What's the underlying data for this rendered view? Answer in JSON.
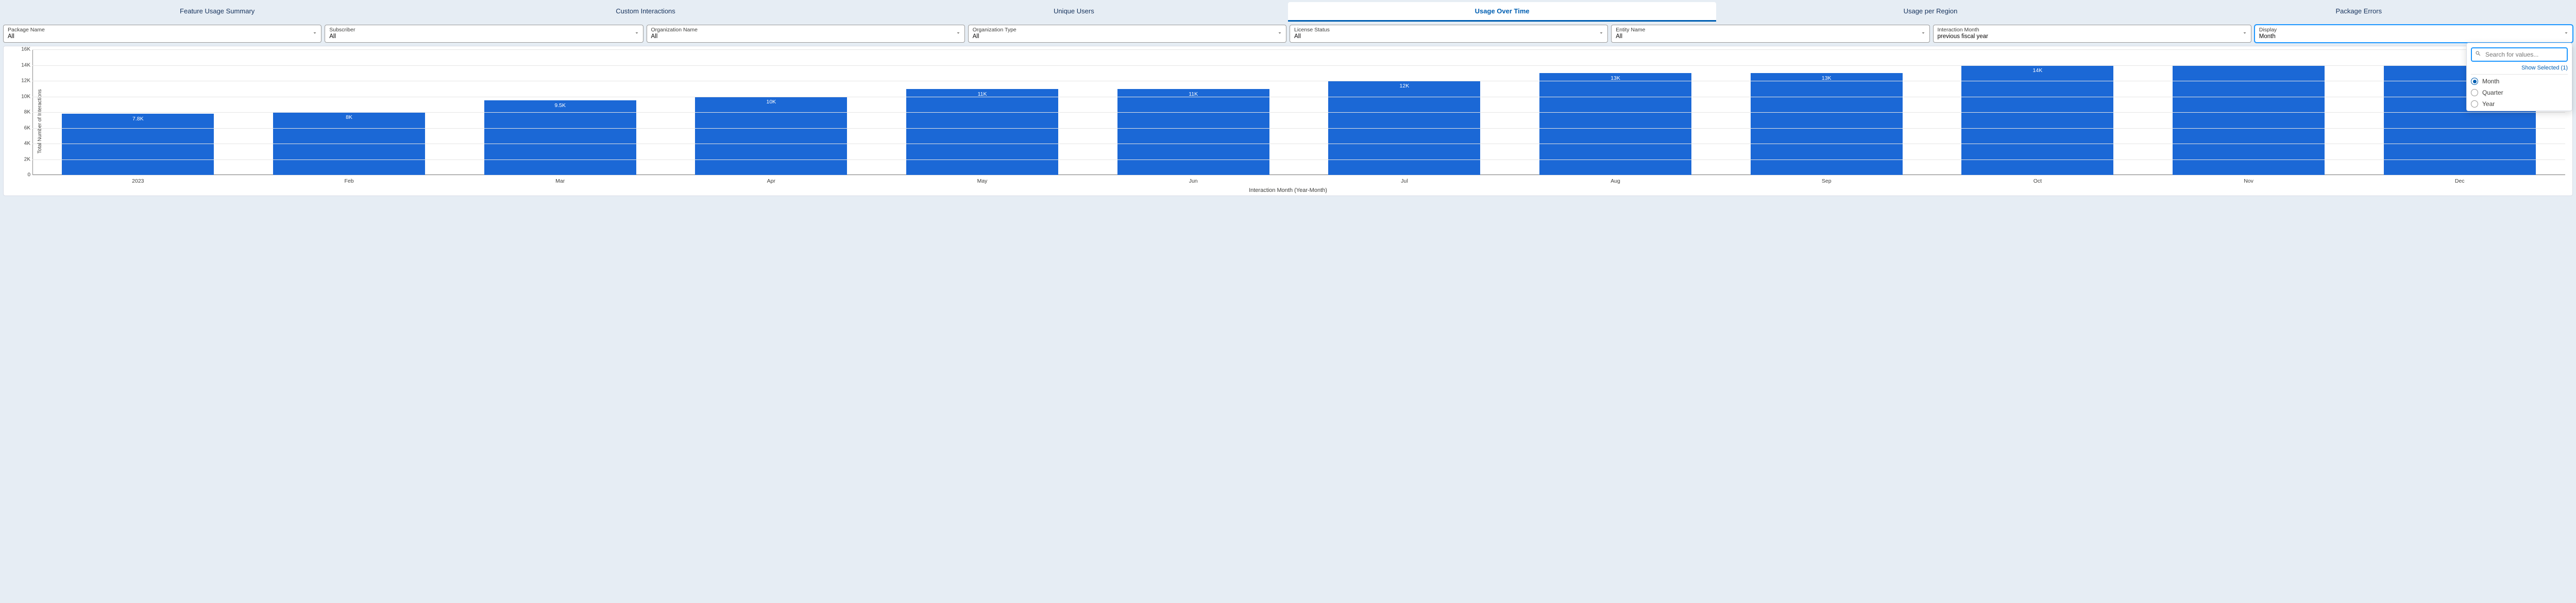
{
  "tabs": [
    {
      "label": "Feature Usage Summary",
      "active": false
    },
    {
      "label": "Custom Interactions",
      "active": false
    },
    {
      "label": "Unique Users",
      "active": false
    },
    {
      "label": "Usage Over Time",
      "active": true
    },
    {
      "label": "Usage per Region",
      "active": false
    },
    {
      "label": "Package Errors",
      "active": false
    }
  ],
  "filters": [
    {
      "label": "Package Name",
      "value": "All"
    },
    {
      "label": "Subscriber",
      "value": "All"
    },
    {
      "label": "Organization Name",
      "value": "All"
    },
    {
      "label": "Organization Type",
      "value": "All"
    },
    {
      "label": "License Status",
      "value": "All"
    },
    {
      "label": "Entity Name",
      "value": "All"
    },
    {
      "label": "Interaction Month",
      "value": "previous fiscal year"
    },
    {
      "label": "Display",
      "value": "Month",
      "focus": true
    }
  ],
  "dropdown": {
    "search_placeholder": "Search for values...",
    "show_selected": "Show Selected (1)",
    "options": [
      {
        "label": "Month",
        "selected": true
      },
      {
        "label": "Quarter",
        "selected": false
      },
      {
        "label": "Year",
        "selected": false
      }
    ]
  },
  "chart_data": {
    "type": "bar",
    "title": "",
    "xlabel": "Interaction Month (Year-Month)",
    "ylabel": "Total Number of Interactions",
    "ylim": [
      0,
      16000
    ],
    "yticks": [
      0,
      2000,
      4000,
      6000,
      8000,
      10000,
      12000,
      14000,
      16000
    ],
    "ytick_labels": [
      "0",
      "2K",
      "4K",
      "6K",
      "8K",
      "10K",
      "12K",
      "14K",
      "16K"
    ],
    "categories": [
      "2023",
      "Feb",
      "Mar",
      "Apr",
      "May",
      "Jun",
      "Jul",
      "Aug",
      "Sep",
      "Oct",
      "Nov",
      "Dec"
    ],
    "values": [
      7800,
      8000,
      9500,
      10000,
      11000,
      11000,
      12000,
      13000,
      13000,
      14000,
      14000,
      14000
    ],
    "data_labels": [
      "7.8K",
      "8K",
      "9.5K",
      "10K",
      "11K",
      "11K",
      "12K",
      "13K",
      "13K",
      "14K",
      "",
      ""
    ]
  }
}
